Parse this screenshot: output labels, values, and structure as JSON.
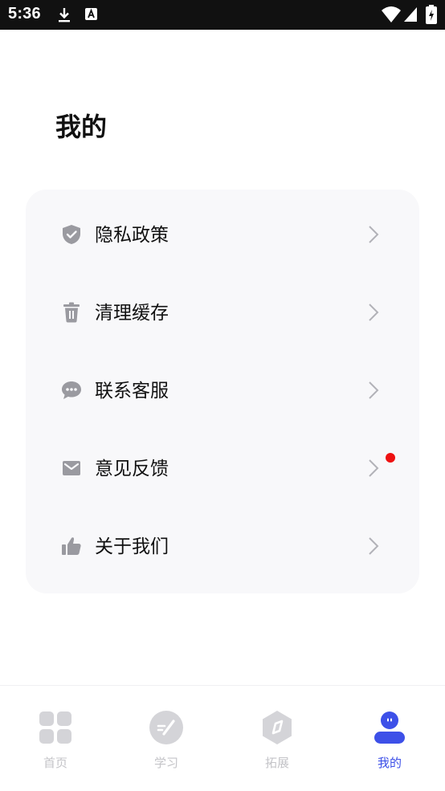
{
  "status_bar": {
    "time": "5:36",
    "icons": [
      "download-icon",
      "text-input-icon",
      "wifi-icon",
      "signal-icon",
      "battery-icon"
    ]
  },
  "page": {
    "title": "我的"
  },
  "menu": {
    "items": [
      {
        "label": "隐私政策",
        "icon": "shield-check-icon"
      },
      {
        "label": "清理缓存",
        "icon": "trash-icon"
      },
      {
        "label": "联系客服",
        "icon": "chat-bubble-icon"
      },
      {
        "label": "意见反馈",
        "icon": "mail-icon",
        "has_notification_dot": true
      },
      {
        "label": "关于我们",
        "icon": "thumbs-up-icon"
      }
    ]
  },
  "bottom_nav": {
    "active_tab": "我的",
    "tabs": [
      {
        "label": "首页",
        "icon": "home-grid-icon"
      },
      {
        "label": "学习",
        "icon": "study-pen-icon"
      },
      {
        "label": "拓展",
        "icon": "compass-icon"
      },
      {
        "label": "我的",
        "icon": "profile-icon"
      }
    ]
  },
  "colors": {
    "accent": "#3d50e8",
    "inactive": "#c4c4c8",
    "card_background": "#f8f8fa",
    "notification_dot": "#ee1111",
    "status_bar": "#111111"
  }
}
